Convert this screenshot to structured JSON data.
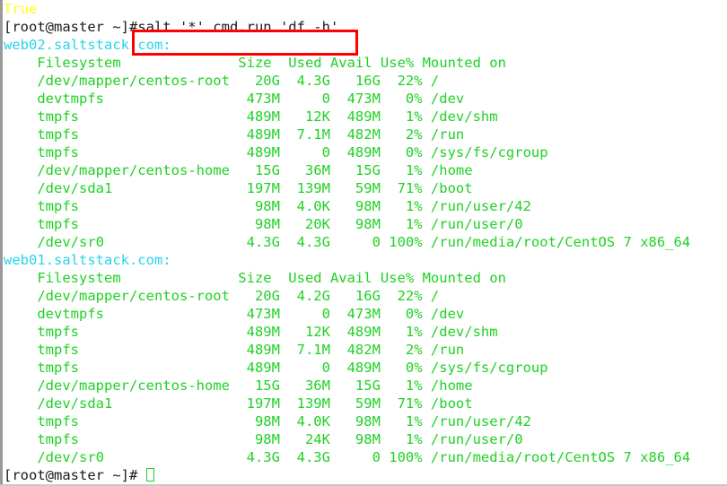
{
  "terminal": {
    "prompt": "[root@master ~]#",
    "prev_output": "True",
    "command": "salt '*' cmd.run 'df -h'",
    "final_prompt": "[root@master ~]#",
    "highlight_color": "#ff0000",
    "colors": {
      "green": "#1fd124",
      "cyan": "#2ad4e8",
      "yellow": "#ffff14",
      "black": "#1a1a1a",
      "background": "#ffffff"
    }
  },
  "minions": [
    {
      "host": "web02.saltstack.com:",
      "header": "    Filesystem              Size  Used Avail Use% Mounted on",
      "rows": [
        "    /dev/mapper/centos-root   20G  4.3G   16G  22% /",
        "    devtmpfs                 473M     0  473M   0% /dev",
        "    tmpfs                    489M   12K  489M   1% /dev/shm",
        "    tmpfs                    489M  7.1M  482M   2% /run",
        "    tmpfs                    489M     0  489M   0% /sys/fs/cgroup",
        "    /dev/mapper/centos-home   15G   36M   15G   1% /home",
        "    /dev/sda1                197M  139M   59M  71% /boot",
        "    tmpfs                     98M  4.0K   98M   1% /run/user/42",
        "    tmpfs                     98M   20K   98M   1% /run/user/0",
        "    /dev/sr0                 4.3G  4.3G     0 100% /run/media/root/CentOS 7 x86_64"
      ]
    },
    {
      "host": "web01.saltstack.com:",
      "header": "    Filesystem              Size  Used Avail Use% Mounted on",
      "rows": [
        "    /dev/mapper/centos-root   20G  4.2G   16G  22% /",
        "    devtmpfs                 473M     0  473M   0% /dev",
        "    tmpfs                    489M   12K  489M   1% /dev/shm",
        "    tmpfs                    489M  7.1M  482M   2% /run",
        "    tmpfs                    489M     0  489M   0% /sys/fs/cgroup",
        "    /dev/mapper/centos-home   15G   36M   15G   1% /home",
        "    /dev/sda1                197M  139M   59M  71% /boot",
        "    tmpfs                     98M  4.0K   98M   1% /run/user/42",
        "    tmpfs                     98M   24K   98M   1% /run/user/0",
        "    /dev/sr0                 4.3G  4.3G     0 100% /run/media/root/CentOS 7 x86_64"
      ]
    }
  ]
}
